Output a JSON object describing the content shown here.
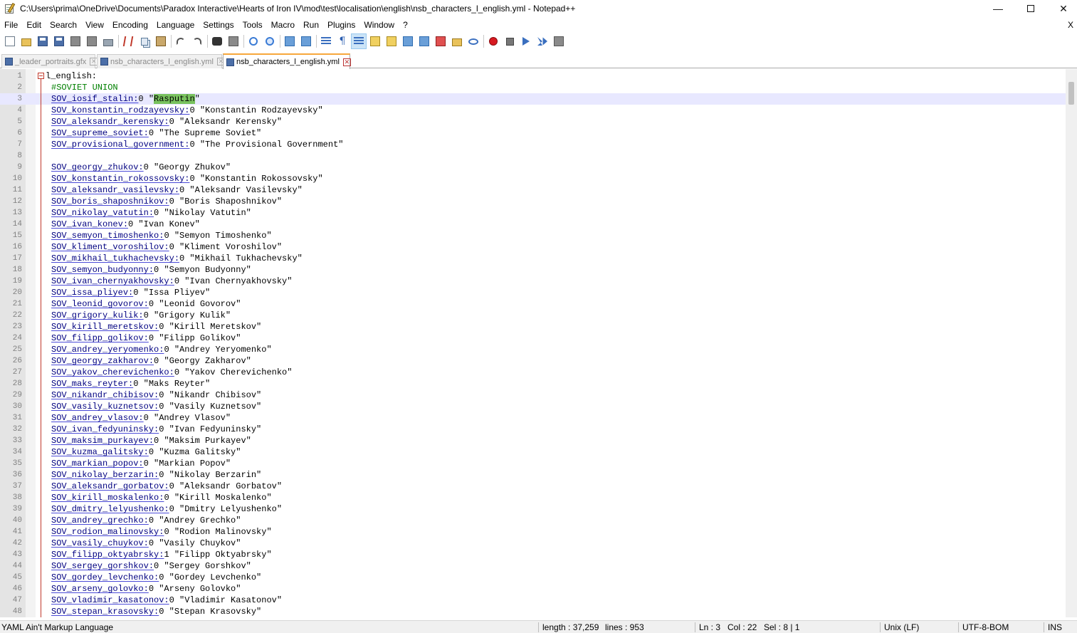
{
  "window": {
    "title": "C:\\Users\\prima\\OneDrive\\Documents\\Paradox Interactive\\Hearts of Iron IV\\mod\\test\\localisation\\english\\nsb_characters_l_english.yml - Notepad++",
    "minimize_glyph": "—",
    "close_glyph": "✕"
  },
  "menu": {
    "items": [
      "File",
      "Edit",
      "Search",
      "View",
      "Encoding",
      "Language",
      "Settings",
      "Tools",
      "Macro",
      "Run",
      "Plugins",
      "Window",
      "?"
    ],
    "close_glyph": "X"
  },
  "toolbar": {
    "icons": [
      "new-file-icon",
      "open-file-icon",
      "save-icon",
      "save-all-icon",
      "close-icon",
      "close-all-icon",
      "print-icon",
      "cut-icon",
      "copy-icon",
      "paste-icon",
      "undo-icon",
      "redo-icon",
      "find-icon",
      "replace-icon",
      "zoom-in-icon",
      "zoom-out-icon",
      "sync-vertical-icon",
      "sync-horizontal-icon",
      "word-wrap-icon",
      "show-all-characters-icon",
      "indent-guide-icon",
      "user-language-icon",
      "document-map-icon",
      "function-list-icon",
      "folder-as-workspace-icon",
      "monitoring-icon",
      "record-macro-icon",
      "stop-recording-icon",
      "playback-macro-icon",
      "run-macro-multiple-icon",
      "save-macro-icon"
    ]
  },
  "tabs": [
    {
      "label": "_leader_portraits.gfx",
      "active": false
    },
    {
      "label": "nsb_characters_l_english.yml",
      "active": false
    },
    {
      "label": "nsb_characters_l_english.yml",
      "active": true
    }
  ],
  "editor": {
    "current_line": 3,
    "highlight_color": "#79c25e",
    "lines": [
      {
        "n": "1",
        "key": "l_english:",
        "rest": "",
        "kind": "header"
      },
      {
        "n": "2",
        "key": "",
        "rest": "#SOVIET UNION",
        "kind": "comment"
      },
      {
        "n": "3",
        "key": "SOV_iosif_stalin:",
        "rest": "0 \"",
        "sel": "Rasputin",
        "after": "\"",
        "kind": "entry"
      },
      {
        "n": "4",
        "key": "SOV_konstantin_rodzayevsky:",
        "rest": "0 \"Konstantin Rodzayevsky\"",
        "kind": "entry"
      },
      {
        "n": "5",
        "key": "SOV_aleksandr_kerensky:",
        "rest": "0 \"Aleksandr Kerensky\"",
        "kind": "entry"
      },
      {
        "n": "6",
        "key": "SOV_supreme_soviet:",
        "rest": "0 \"The Supreme Soviet\"",
        "kind": "entry"
      },
      {
        "n": "7",
        "key": "SOV_provisional_government:",
        "rest": "0 \"The Provisional Government\"",
        "kind": "entry"
      },
      {
        "n": "8",
        "key": "",
        "rest": "",
        "kind": "blank"
      },
      {
        "n": "9",
        "key": "SOV_georgy_zhukov:",
        "rest": "0 \"Georgy Zhukov\"",
        "kind": "entry"
      },
      {
        "n": "10",
        "key": "SOV_konstantin_rokossovsky:",
        "rest": "0 \"Konstantin Rokossovsky\"",
        "kind": "entry"
      },
      {
        "n": "11",
        "key": "SOV_aleksandr_vasilevsky:",
        "rest": "0 \"Aleksandr Vasilevsky\"",
        "kind": "entry"
      },
      {
        "n": "12",
        "key": "SOV_boris_shaposhnikov:",
        "rest": "0 \"Boris Shaposhnikov\"",
        "kind": "entry"
      },
      {
        "n": "13",
        "key": "SOV_nikolay_vatutin:",
        "rest": "0 \"Nikolay Vatutin\"",
        "kind": "entry"
      },
      {
        "n": "14",
        "key": "SOV_ivan_konev:",
        "rest": "0 \"Ivan Konev\"",
        "kind": "entry"
      },
      {
        "n": "15",
        "key": "SOV_semyon_timoshenko:",
        "rest": "0 \"Semyon Timoshenko\"",
        "kind": "entry"
      },
      {
        "n": "16",
        "key": "SOV_kliment_voroshilov:",
        "rest": "0 \"Kliment Voroshilov\"",
        "kind": "entry"
      },
      {
        "n": "17",
        "key": "SOV_mikhail_tukhachevsky:",
        "rest": "0 \"Mikhail Tukhachevsky\"",
        "kind": "entry"
      },
      {
        "n": "18",
        "key": "SOV_semyon_budyonny:",
        "rest": "0 \"Semyon Budyonny\"",
        "kind": "entry"
      },
      {
        "n": "19",
        "key": "SOV_ivan_chernyakhovsky:",
        "rest": "0 \"Ivan Chernyakhovsky\"",
        "kind": "entry"
      },
      {
        "n": "20",
        "key": "SOV_issa_pliyev:",
        "rest": "0 \"Issa Pliyev\"",
        "kind": "entry"
      },
      {
        "n": "21",
        "key": "SOV_leonid_govorov:",
        "rest": "0 \"Leonid Govorov\"",
        "kind": "entry"
      },
      {
        "n": "22",
        "key": "SOV_grigory_kulik:",
        "rest": "0 \"Grigory Kulik\"",
        "kind": "entry"
      },
      {
        "n": "23",
        "key": "SOV_kirill_meretskov:",
        "rest": "0 \"Kirill Meretskov\"",
        "kind": "entry"
      },
      {
        "n": "24",
        "key": "SOV_filipp_golikov:",
        "rest": "0 \"Filipp Golikov\"",
        "kind": "entry"
      },
      {
        "n": "25",
        "key": "SOV_andrey_yeryomenko:",
        "rest": "0 \"Andrey Yeryomenko\"",
        "kind": "entry"
      },
      {
        "n": "26",
        "key": "SOV_georgy_zakharov:",
        "rest": "0 \"Georgy Zakharov\"",
        "kind": "entry"
      },
      {
        "n": "27",
        "key": "SOV_yakov_cherevichenko:",
        "rest": "0 \"Yakov Cherevichenko\"",
        "kind": "entry"
      },
      {
        "n": "28",
        "key": "SOV_maks_reyter:",
        "rest": "0 \"Maks Reyter\"",
        "kind": "entry"
      },
      {
        "n": "29",
        "key": "SOV_nikandr_chibisov:",
        "rest": "0 \"Nikandr Chibisov\"",
        "kind": "entry"
      },
      {
        "n": "30",
        "key": "SOV_vasily_kuznetsov:",
        "rest": "0 \"Vasily Kuznetsov\"",
        "kind": "entry"
      },
      {
        "n": "31",
        "key": "SOV_andrey_vlasov:",
        "rest": "0 \"Andrey Vlasov\"",
        "kind": "entry"
      },
      {
        "n": "32",
        "key": "SOV_ivan_fedyuninsky:",
        "rest": "0 \"Ivan Fedyuninsky\"",
        "kind": "entry"
      },
      {
        "n": "33",
        "key": "SOV_maksim_purkayev:",
        "rest": "0 \"Maksim Purkayev\"",
        "kind": "entry"
      },
      {
        "n": "34",
        "key": "SOV_kuzma_galitsky:",
        "rest": "0 \"Kuzma Galitsky\"",
        "kind": "entry"
      },
      {
        "n": "35",
        "key": "SOV_markian_popov:",
        "rest": "0 \"Markian Popov\"",
        "kind": "entry"
      },
      {
        "n": "36",
        "key": "SOV_nikolay_berzarin:",
        "rest": "0 \"Nikolay Berzarin\"",
        "kind": "entry"
      },
      {
        "n": "37",
        "key": "SOV_aleksandr_gorbatov:",
        "rest": "0 \"Aleksandr Gorbatov\"",
        "kind": "entry"
      },
      {
        "n": "38",
        "key": "SOV_kirill_moskalenko:",
        "rest": "0 \"Kirill Moskalenko\"",
        "kind": "entry"
      },
      {
        "n": "39",
        "key": "SOV_dmitry_lelyushenko:",
        "rest": "0 \"Dmitry Lelyushenko\"",
        "kind": "entry"
      },
      {
        "n": "40",
        "key": "SOV_andrey_grechko:",
        "rest": "0 \"Andrey Grechko\"",
        "kind": "entry"
      },
      {
        "n": "41",
        "key": "SOV_rodion_malinovsky:",
        "rest": "0 \"Rodion Malinovsky\"",
        "kind": "entry"
      },
      {
        "n": "42",
        "key": "SOV_vasily_chuykov:",
        "rest": "0 \"Vasily Chuykov\"",
        "kind": "entry"
      },
      {
        "n": "43",
        "key": "SOV_filipp_oktyabrsky:",
        "rest": "1 \"Filipp Oktyabrsky\"",
        "kind": "entry"
      },
      {
        "n": "44",
        "key": "SOV_sergey_gorshkov:",
        "rest": "0 \"Sergey Gorshkov\"",
        "kind": "entry"
      },
      {
        "n": "45",
        "key": "SOV_gordey_levchenko:",
        "rest": "0 \"Gordey Levchenko\"",
        "kind": "entry"
      },
      {
        "n": "46",
        "key": "SOV_arseny_golovko:",
        "rest": "0 \"Arseny Golovko\"",
        "kind": "entry"
      },
      {
        "n": "47",
        "key": "SOV_vladimir_kasatonov:",
        "rest": "0 \"Vladimir Kasatonov\"",
        "kind": "entry"
      },
      {
        "n": "48",
        "key": "SOV_stepan_krasovsky:",
        "rest": "0 \"Stepan Krasovsky\"",
        "kind": "entry"
      }
    ]
  },
  "status": {
    "language": "YAML Ain't Markup Language",
    "length": "length : 37,259",
    "lines": "lines : 953",
    "ln": "Ln : 3",
    "col": "Col : 22",
    "sel": "Sel : 8 | 1",
    "eol": "Unix (LF)",
    "encoding": "UTF-8-BOM",
    "mode": "INS"
  }
}
